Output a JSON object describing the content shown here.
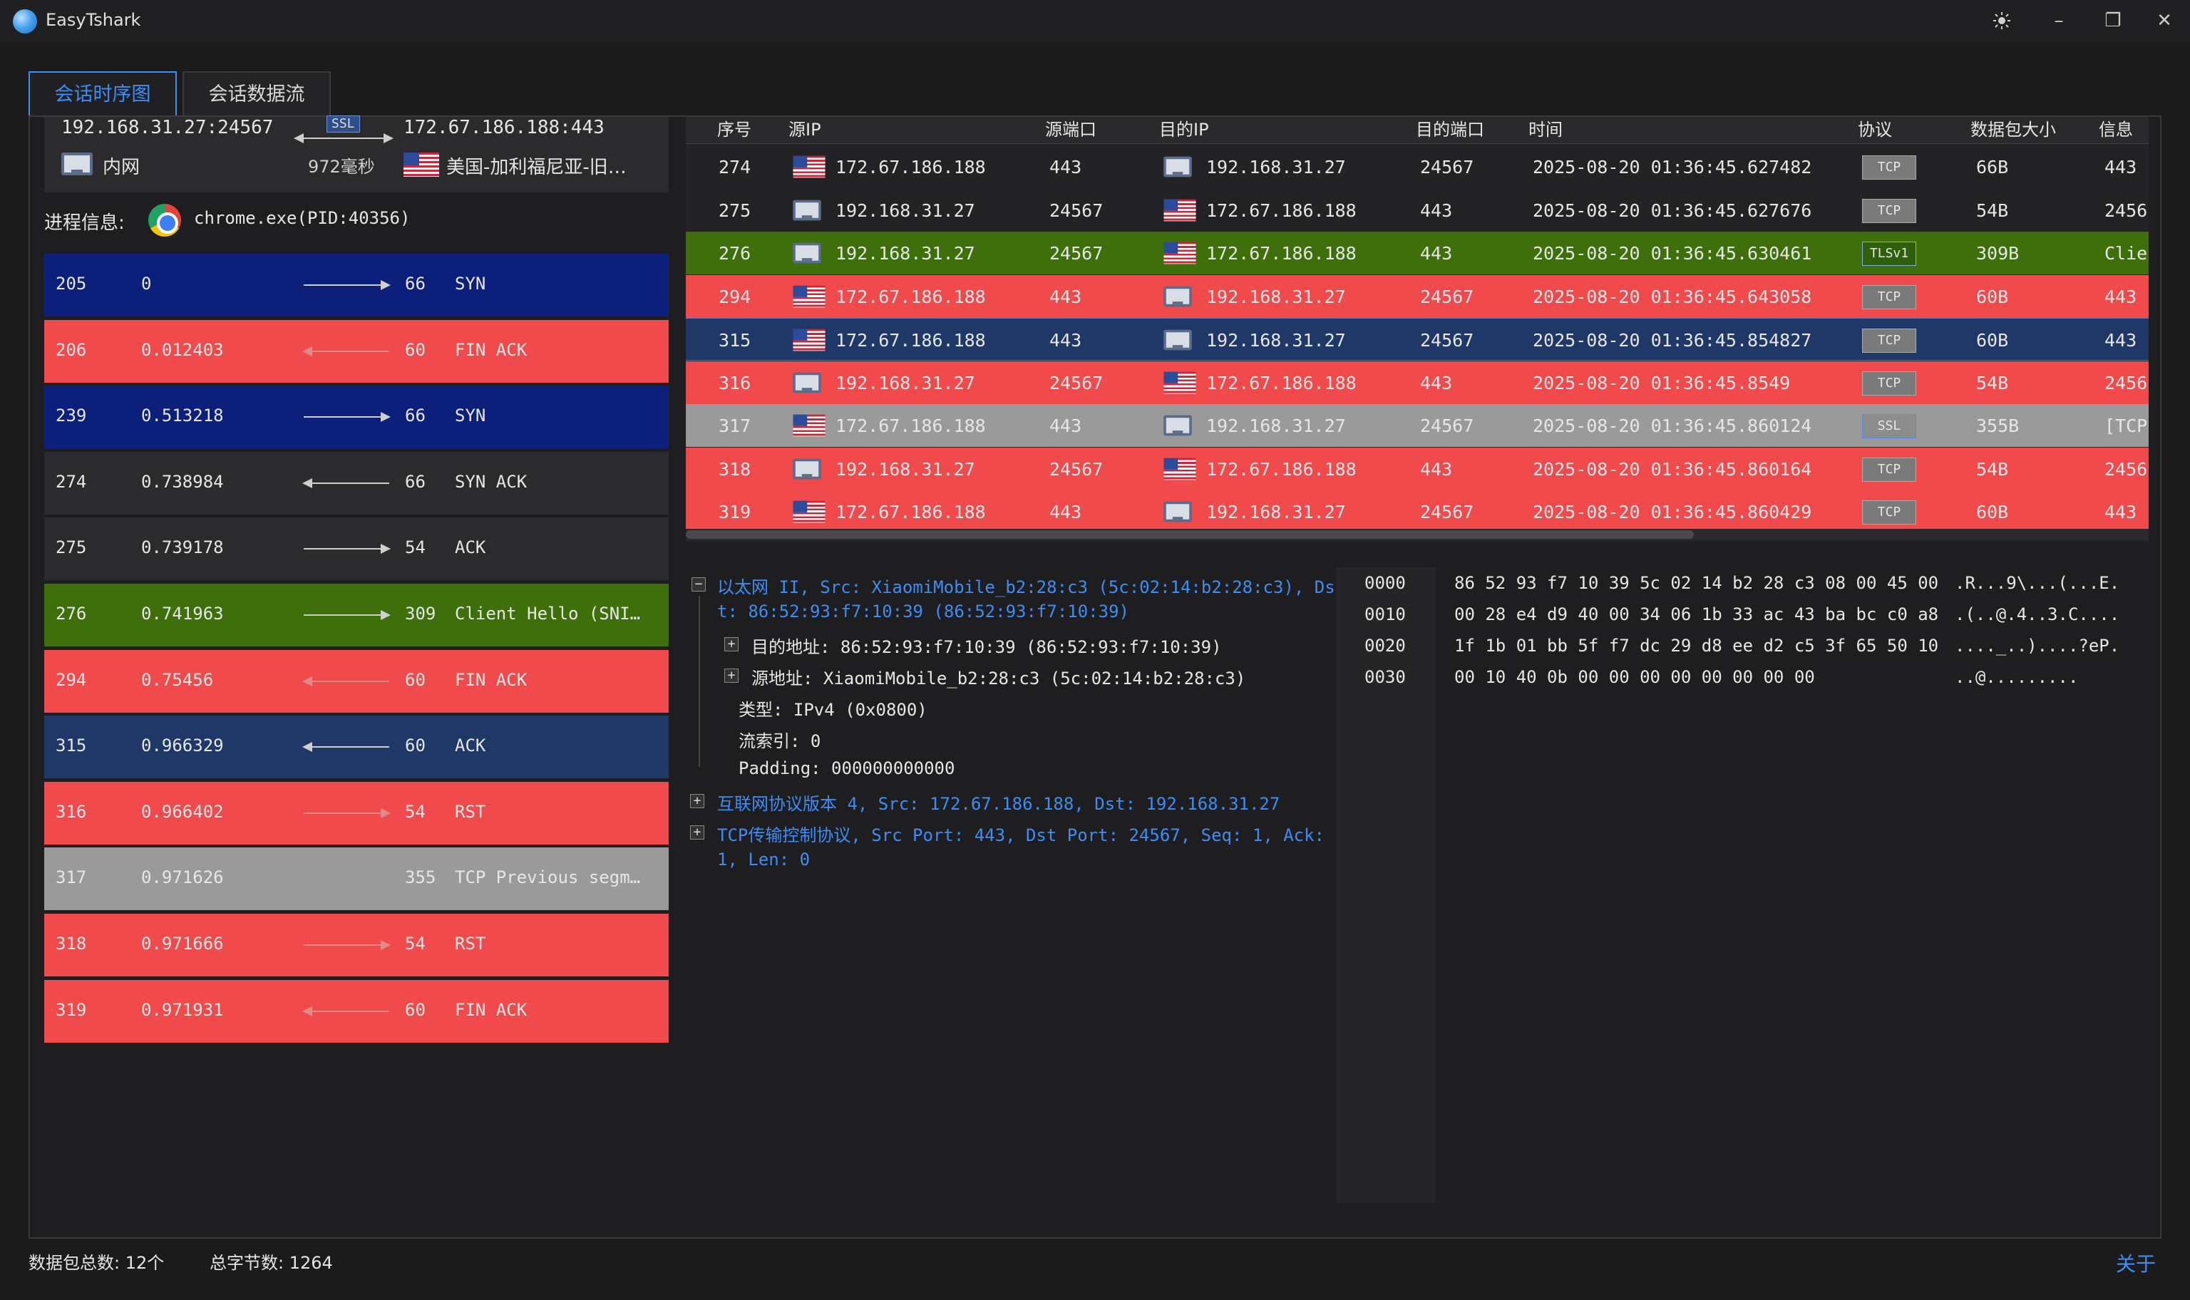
{
  "app": {
    "title": "EasyTshark"
  },
  "window": {
    "theme_icon": "sun-icon",
    "minimize": "–",
    "restore": "❐",
    "close": "✕"
  },
  "tabs": [
    {
      "label": "会话时序图",
      "active": true
    },
    {
      "label": "会话数据流",
      "active": false
    }
  ],
  "session": {
    "src": "192.168.31.27:24567",
    "dst": "172.67.186.188:443",
    "protocol_badge": "SSL",
    "duration": "972毫秒",
    "src_location": "内网",
    "dst_location": "美国-加利福尼亚-旧…"
  },
  "process": {
    "label": "进程信息:",
    "value": "chrome.exe(PID:40356)"
  },
  "sequence": [
    {
      "no": "205",
      "time": "0",
      "dir": "right",
      "len": "66",
      "info": "SYN",
      "color": "#0c1f7a"
    },
    {
      "no": "206",
      "time": "0.012403",
      "dir": "left",
      "len": "60",
      "info": "FIN ACK",
      "color": "#f04a4c"
    },
    {
      "no": "239",
      "time": "0.513218",
      "dir": "right",
      "len": "66",
      "info": "SYN",
      "color": "#0c1f7a"
    },
    {
      "no": "274",
      "time": "0.738984",
      "dir": "left",
      "len": "66",
      "info": "SYN ACK",
      "color": "#2b2b2e"
    },
    {
      "no": "275",
      "time": "0.739178",
      "dir": "right",
      "len": "54",
      "info": "ACK",
      "color": "#2b2b2e"
    },
    {
      "no": "276",
      "time": "0.741963",
      "dir": "right",
      "len": "309",
      "info": "Client Hello (SNI…",
      "color": "#3f6f0b"
    },
    {
      "no": "294",
      "time": "0.75456",
      "dir": "left",
      "len": "60",
      "info": "FIN ACK",
      "color": "#f04a4c"
    },
    {
      "no": "315",
      "time": "0.966329",
      "dir": "left",
      "len": "60",
      "info": "ACK",
      "color": "#1f3868"
    },
    {
      "no": "316",
      "time": "0.966402",
      "dir": "right",
      "len": "54",
      "info": "RST",
      "color": "#f04a4c"
    },
    {
      "no": "317",
      "time": "0.971626",
      "dir": "none",
      "len": "355",
      "info": "TCP Previous segm…",
      "color": "#9a9a9a"
    },
    {
      "no": "318",
      "time": "0.971666",
      "dir": "right",
      "len": "54",
      "info": "RST",
      "color": "#f04a4c"
    },
    {
      "no": "319",
      "time": "0.971931",
      "dir": "left",
      "len": "60",
      "info": "FIN ACK",
      "color": "#f04a4c"
    }
  ],
  "packet_table": {
    "headers": [
      "序号",
      "源IP",
      "源端口",
      "目的IP",
      "目的端口",
      "时间",
      "协议",
      "数据包大小",
      "信息"
    ],
    "rows": [
      {
        "no": "274",
        "src_ip": "172.67.186.188",
        "src_flag": "us",
        "src_port": "443",
        "dst_ip": "192.168.31.27",
        "dst_flag": "pc",
        "dst_port": "24567",
        "time": "2025-08-20 01:36:45.627482",
        "proto": "TCP",
        "size": "66B",
        "info": "443 -",
        "color": "#232325"
      },
      {
        "no": "275",
        "src_ip": "192.168.31.27",
        "src_flag": "pc",
        "src_port": "24567",
        "dst_ip": "172.67.186.188",
        "dst_flag": "us",
        "dst_port": "443",
        "time": "2025-08-20 01:36:45.627676",
        "proto": "TCP",
        "size": "54B",
        "info": "2456",
        "color": "#232325"
      },
      {
        "no": "276",
        "src_ip": "192.168.31.27",
        "src_flag": "pc",
        "src_port": "24567",
        "dst_ip": "172.67.186.188",
        "dst_flag": "us",
        "dst_port": "443",
        "time": "2025-08-20 01:36:45.630461",
        "proto": "TLSv1",
        "size": "309B",
        "info": "Clie",
        "color": "#3f6f0b"
      },
      {
        "no": "294",
        "src_ip": "172.67.186.188",
        "src_flag": "us",
        "src_port": "443",
        "dst_ip": "192.168.31.27",
        "dst_flag": "pc",
        "dst_port": "24567",
        "time": "2025-08-20 01:36:45.643058",
        "proto": "TCP",
        "size": "60B",
        "info": "443 -",
        "color": "#f04a4c"
      },
      {
        "no": "315",
        "src_ip": "172.67.186.188",
        "src_flag": "us",
        "src_port": "443",
        "dst_ip": "192.168.31.27",
        "dst_flag": "pc",
        "dst_port": "24567",
        "time": "2025-08-20 01:36:45.854827",
        "proto": "TCP",
        "size": "60B",
        "info": "443 -",
        "color": "#1f3868"
      },
      {
        "no": "316",
        "src_ip": "192.168.31.27",
        "src_flag": "pc",
        "src_port": "24567",
        "dst_ip": "172.67.186.188",
        "dst_flag": "us",
        "dst_port": "443",
        "time": "2025-08-20 01:36:45.8549",
        "proto": "TCP",
        "size": "54B",
        "info": "2456",
        "color": "#f04a4c"
      },
      {
        "no": "317",
        "src_ip": "172.67.186.188",
        "src_flag": "us",
        "src_port": "443",
        "dst_ip": "192.168.31.27",
        "dst_flag": "pc",
        "dst_port": "24567",
        "time": "2025-08-20 01:36:45.860124",
        "proto": "SSL",
        "size": "355B",
        "info": "[TCP",
        "color": "#9a9a9a"
      },
      {
        "no": "318",
        "src_ip": "192.168.31.27",
        "src_flag": "pc",
        "src_port": "24567",
        "dst_ip": "172.67.186.188",
        "dst_flag": "us",
        "dst_port": "443",
        "time": "2025-08-20 01:36:45.860164",
        "proto": "TCP",
        "size": "54B",
        "info": "2456",
        "color": "#f04a4c"
      },
      {
        "no": "319",
        "src_ip": "172.67.186.188",
        "src_flag": "us",
        "src_port": "443",
        "dst_ip": "192.168.31.27",
        "dst_flag": "pc",
        "dst_port": "24567",
        "time": "2025-08-20 01:36:45.860429",
        "proto": "TCP",
        "size": "60B",
        "info": "443 -",
        "color": "#f04a4c"
      }
    ]
  },
  "detail_tree": {
    "ethernet_line1": "以太网 II, Src: XiaomiMobile_b2:28:c3 (5c:02:14:b2:28:c3), Ds",
    "ethernet_line2": "t: 86:52:93:f7:10:39 (86:52:93:f7:10:39)",
    "dst_addr": "目的地址: 86:52:93:f7:10:39 (86:52:93:f7:10:39)",
    "src_addr": "源地址: XiaomiMobile_b2:28:c3 (5c:02:14:b2:28:c3)",
    "type": "类型: IPv4 (0x0800)",
    "stream_index": "流索引: 0",
    "padding": "Padding: 000000000000",
    "ip_line": "互联网协议版本 4, Src: 172.67.186.188, Dst: 192.168.31.27",
    "tcp_line1": "TCP传输控制协议, Src Port: 443, Dst Port: 24567, Seq: 1, Ack:",
    "tcp_line2": "1, Len: 0"
  },
  "hex": {
    "offsets": [
      "0000",
      "0010",
      "0020",
      "0030"
    ],
    "bytes": [
      "86 52 93 f7 10 39 5c 02 14 b2 28 c3 08 00 45 00",
      "00 28 e4 d9 40 00 34 06 1b 33 ac 43 ba bc c0 a8",
      "1f 1b 01 bb 5f f7 dc 29 d8 ee d2 c5 3f 65 50 10",
      "00 10 40 0b 00 00 00 00 00 00 00 00"
    ],
    "ascii": [
      ".R...9\\...(...E.",
      ".(..@.4..3.C....",
      "...._..)....?eP.",
      "..@........."
    ]
  },
  "status": {
    "packet_count": "数据包总数: 12个",
    "byte_count": "总字节数: 1264",
    "about": "关于"
  }
}
